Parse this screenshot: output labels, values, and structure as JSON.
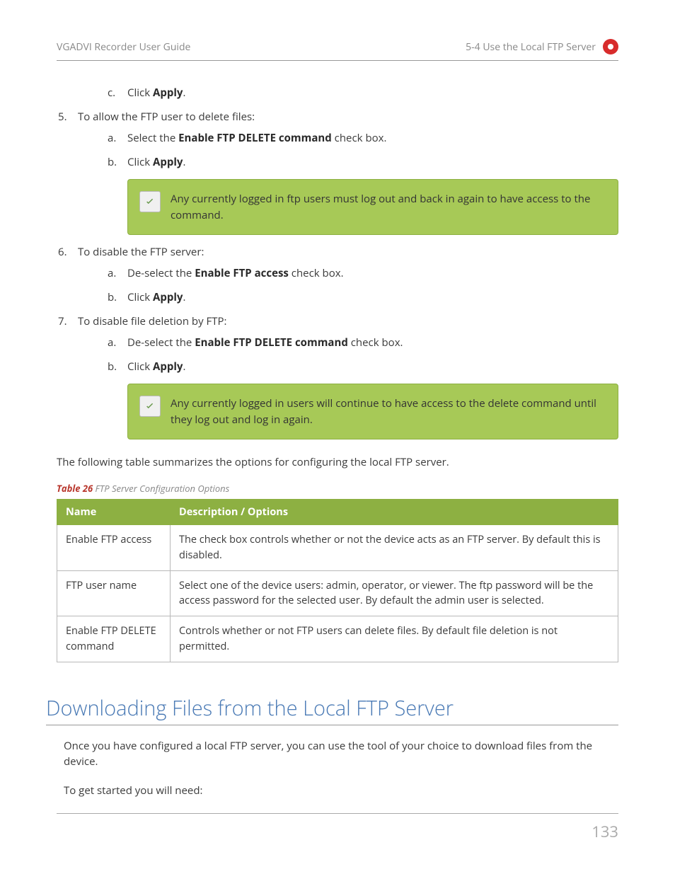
{
  "header": {
    "left": "VGADVI Recorder User Guide",
    "right": "5-4 Use the Local FTP Server"
  },
  "steps": {
    "s4c_prefix": "Click ",
    "s4c_bold": "Apply",
    "s4c_suffix": ".",
    "s5_text": "To allow the FTP user to delete files:",
    "s5a_prefix": "Select the ",
    "s5a_bold": "Enable FTP DELETE command",
    "s5a_suffix": " check box.",
    "s5b_prefix": "Click ",
    "s5b_bold": "Apply",
    "s5b_suffix": ".",
    "callout1": "Any currently logged in ftp users must log out and back in again to have access to the command.",
    "s6_text": "To disable the FTP server:",
    "s6a_prefix": "De-select the ",
    "s6a_bold": "Enable FTP access",
    "s6a_suffix": " check box.",
    "s6b_prefix": "Click ",
    "s6b_bold": "Apply",
    "s6b_suffix": ".",
    "s7_text": "To disable file deletion by FTP:",
    "s7a_prefix": "De-select the ",
    "s7a_bold": "Enable FTP DELETE command",
    "s7a_suffix": " check box.",
    "s7b_prefix": "Click ",
    "s7b_bold": "Apply",
    "s7b_suffix": ".",
    "callout2": "Any currently logged in users will continue to have access to the delete command until they log out and log in again."
  },
  "summary": "The following table summarizes the options for configuring the local FTP server.",
  "table_caption": {
    "label": "Table 26",
    "title": " FTP Server Configuration Options"
  },
  "table": {
    "h1": "Name",
    "h2": "Description / Options",
    "r1c1": "Enable FTP access",
    "r1c2": "The check box controls whether or not the device acts as an FTP server. By default this is disabled.",
    "r2c1": "FTP user name",
    "r2c2": "Select one of the device users: admin, operator, or viewer. The ftp password will be the access password for the selected user. By default the admin user is selected.",
    "r3c1": "Enable FTP DELETE command",
    "r3c2": "Controls whether or not FTP users can delete files. By default file deletion is not permitted."
  },
  "section_heading": "Downloading Files from the Local FTP Server",
  "para1": "Once you have configured a local FTP server, you can use the tool of your choice to download files from the device.",
  "para2": "To get started you will need:",
  "page_number": "133"
}
